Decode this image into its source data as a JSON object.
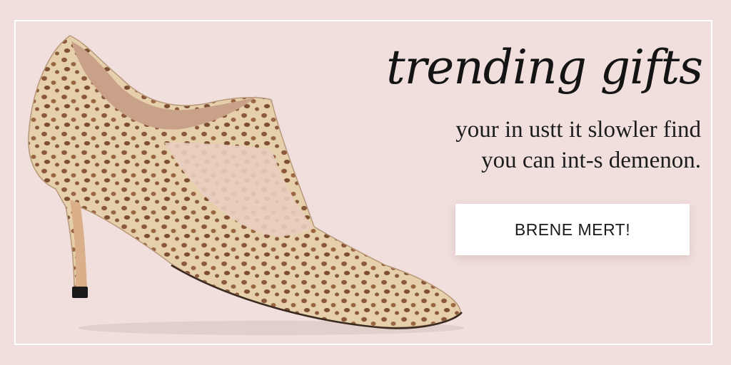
{
  "banner": {
    "headline": "trending gifts",
    "subline_1": "your in ustt it slowler find",
    "subline_2": "you can int-s demenon.",
    "cta_label": "BRENE MERT!"
  },
  "colors": {
    "background": "#f1dfdd",
    "frame": "#ffffff",
    "shoe_base": "#e6cfab",
    "shoe_spots": "#8b5a3a",
    "heel_tip": "#1a1a1a"
  },
  "icons": {
    "product_image": "leopard-print-pump-shoe-icon"
  }
}
